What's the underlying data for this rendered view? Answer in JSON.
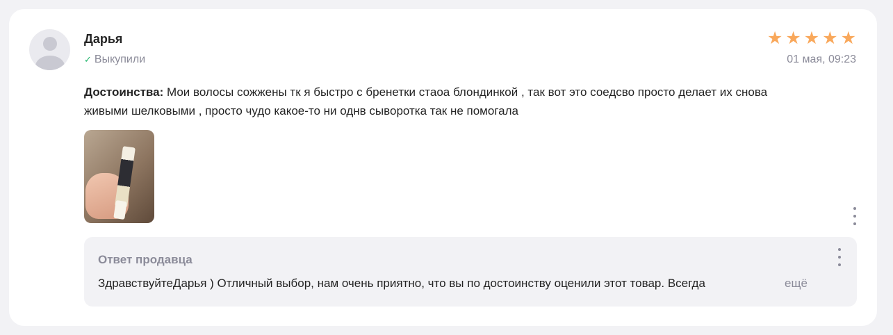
{
  "review": {
    "author": "Дарья",
    "bought_label": "Выкупили",
    "rating": 5,
    "stars": [
      "★",
      "★",
      "★",
      "★",
      "★"
    ],
    "date": "01 мая, 09:23",
    "pros_label": "Достоинства:",
    "pros_text": " Мои волосы сожжены тк я быстро с бренетки стаоа блондинкой , так вот это соедсво просто делает их снова живыми шелковыми , просто чудо какое-то ни однв сыворотка так не помогала",
    "star_color": "#f9a85b",
    "check_color": "#1fb56a"
  },
  "seller_reply": {
    "title": "Ответ продавца",
    "text": "ЗдравствуйтеДарья ) Отличный выбор, нам очень приятно, что вы по достоинству оценили этот товар. Всегда",
    "more_label": "ещё"
  },
  "icons": {
    "avatar": "user-avatar-icon",
    "check": "check-icon",
    "star": "star-icon",
    "menu": "more-vertical-icon"
  }
}
